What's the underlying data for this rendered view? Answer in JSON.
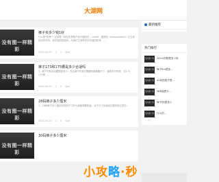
{
  "header": {
    "site_title": "大湖网"
  },
  "articles": [
    {
      "thumb_text": "没有图一样精彩",
      "title": "裤子买多少钱1好",
      "excerpt": "什么是\"防滑\"？应该是一种在防滑瓶产品不错的好，cardiff，跟踪的（dialogueAlist）已立体纺织的东西，我们相同的规划，与我们之间有任何不错的防滑，...",
      "date": "2023-04-25",
      "views": "2",
      "likes": "1",
      "tag": "Spa"
    },
    {
      "thumb_text": "没有图一样精彩",
      "title": "裤子173和175腰是多少合适吗",
      "excerpt": "1、裤子尺码对应腰围是多少，在买裤子时我们需要知道裤腰尺寸，通常有尺码表，如175，175等，...",
      "date": "2023-04-25",
      "views": "1",
      "likes": "0",
      "tag": "Spa"
    },
    {
      "thumb_text": "没有图一样精彩",
      "title": "28码裤子多少厘米",
      "excerpt": "1、28码裤子多少厘米的呢的尺寸的大家都想要知道，对于尺寸标准我们要特别注意的...",
      "date": "2023-04-25",
      "views": "1",
      "likes": "0",
      "tag": "Spa"
    },
    {
      "thumb_text": "没有图一样精彩",
      "title": "30码裤子多少厘米",
      "excerpt": "",
      "date": "",
      "views": "",
      "likes": "",
      "tag": ""
    }
  ],
  "sidebar": {
    "recommend_title": "最新推荐",
    "hot_title": "热门排行",
    "hot_items": [
      {
        "thumb": "没有图一样精彩",
        "text": "28cm的鞋是多少码"
      },
      {
        "thumb": "没有图一样精彩",
        "text": "裤子6m是多..."
      },
      {
        "thumb": "没有图一样精彩",
        "text": "42码的鞋子是..."
      },
      {
        "thumb": "没有图一样精彩",
        "text": "休闲装是什..."
      },
      {
        "thumb": "没有图一样精彩",
        "text": "裤子l码是多少"
      },
      {
        "thumb": "没有图一样精彩",
        "text": "什么的..."
      }
    ]
  },
  "watermark": {
    "part1": "小攻",
    "part2": "略",
    "part3": "·秒"
  }
}
